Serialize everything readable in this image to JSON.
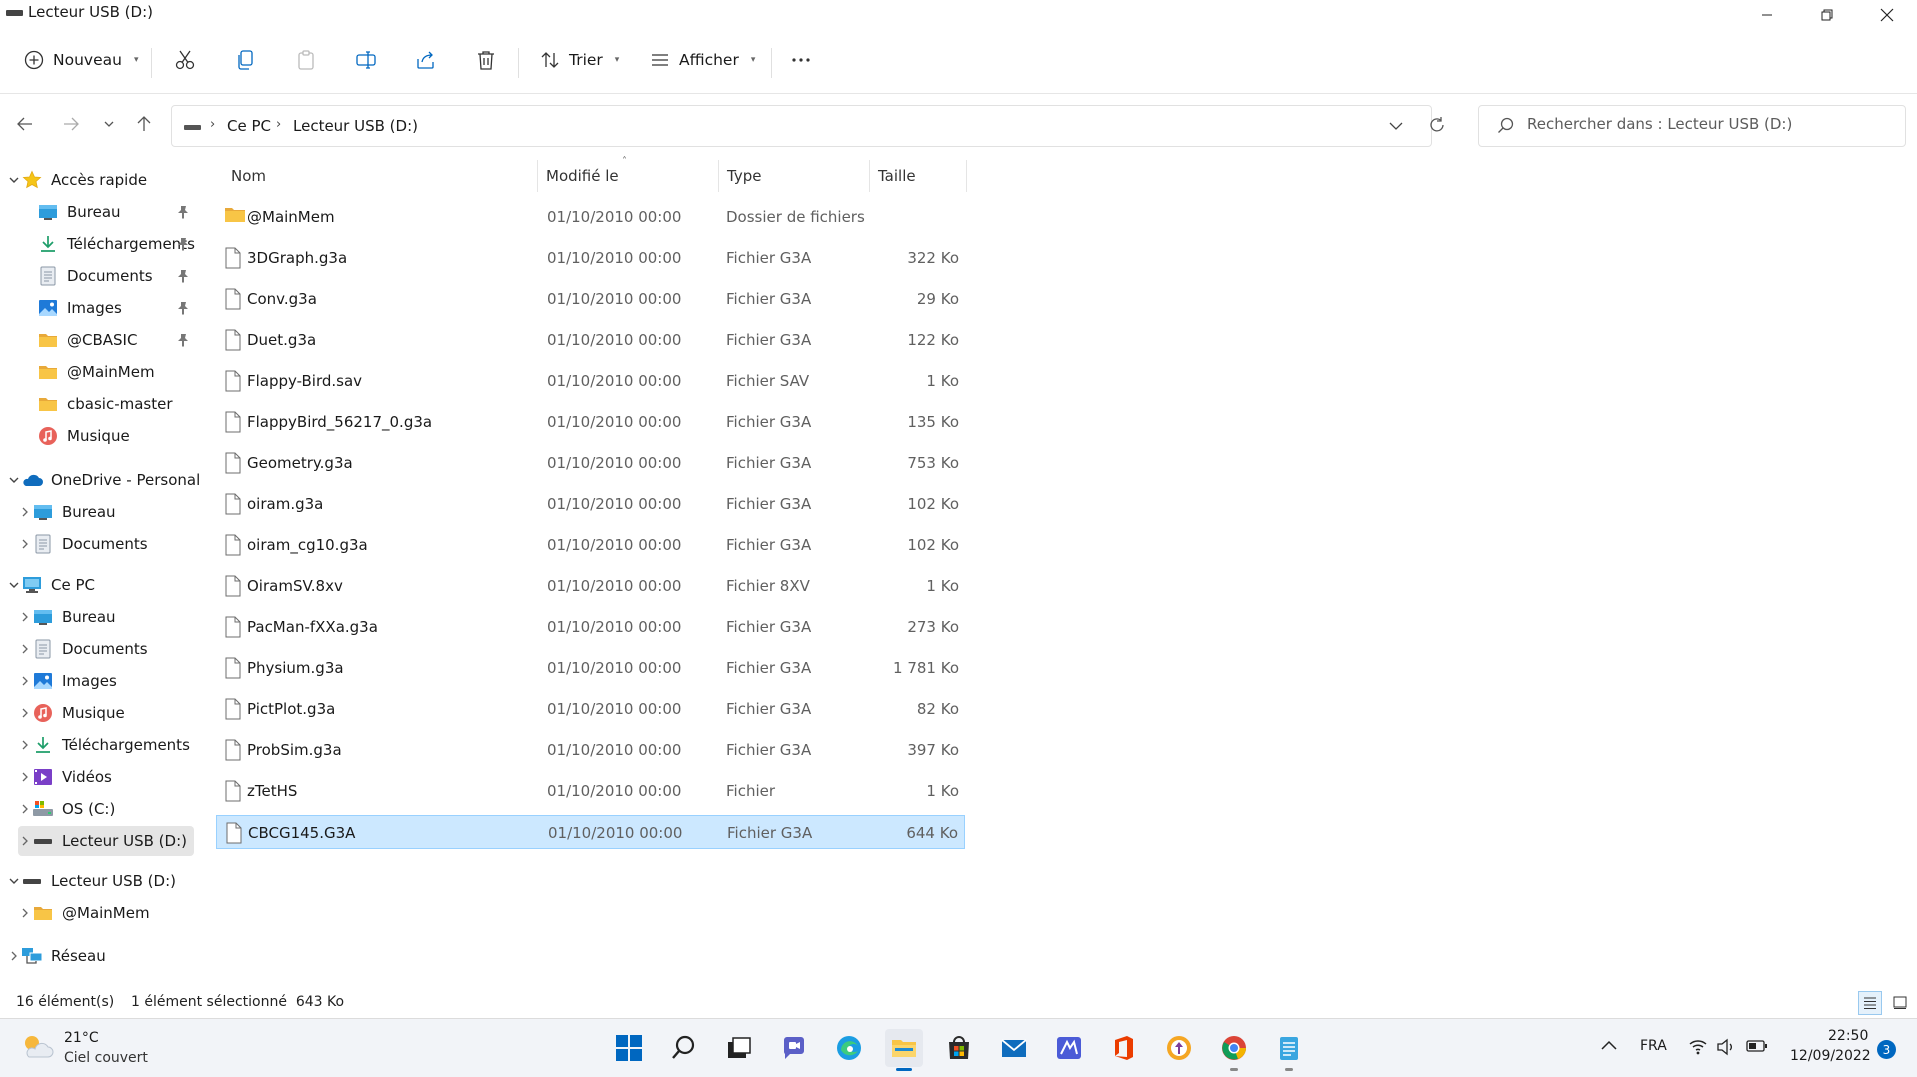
{
  "window": {
    "title": "Lecteur USB (D:)",
    "minimize_icon": "minimize-icon",
    "maximize_icon": "restore-icon",
    "close_icon": "close-icon"
  },
  "commandbar": {
    "new_label": "Nouveau",
    "sort_label": "Trier",
    "view_label": "Afficher",
    "icons": [
      "cut-icon",
      "copy-icon",
      "paste-icon",
      "rename-icon",
      "share-icon",
      "delete-icon",
      "more-icon"
    ]
  },
  "address": {
    "crumbs": [
      "Ce PC",
      "Lecteur USB (D:)"
    ]
  },
  "search": {
    "placeholder": "Rechercher dans : Lecteur USB (D:)"
  },
  "sidebar": {
    "quick_access": "Accès rapide",
    "quick_items": [
      {
        "label": "Bureau",
        "pinned": true
      },
      {
        "label": "Téléchargements",
        "pinned": true
      },
      {
        "label": "Documents",
        "pinned": true
      },
      {
        "label": "Images",
        "pinned": true
      },
      {
        "label": "@CBASIC",
        "pinned": true
      },
      {
        "label": "@MainMem",
        "pinned": false
      },
      {
        "label": "cbasic-master",
        "pinned": false
      },
      {
        "label": "Musique",
        "pinned": false
      }
    ],
    "onedrive": "OneDrive - Personal",
    "onedrive_items": [
      "Bureau",
      "Documents"
    ],
    "this_pc": "Ce PC",
    "pc_items": [
      "Bureau",
      "Documents",
      "Images",
      "Musique",
      "Téléchargements",
      "Vidéos",
      "OS (C:)",
      "Lecteur USB (D:)"
    ],
    "usb": "Lecteur USB (D:)",
    "usb_items": [
      "@MainMem"
    ],
    "network": "Réseau"
  },
  "columns": {
    "name": "Nom",
    "modified": "Modifié le",
    "type": "Type",
    "size": "Taille"
  },
  "files": [
    {
      "name": "@MainMem",
      "date": "01/10/2010 00:00",
      "type": "Dossier de fichiers",
      "size": "",
      "folder": true
    },
    {
      "name": "3DGraph.g3a",
      "date": "01/10/2010 00:00",
      "type": "Fichier G3A",
      "size": "322 Ko"
    },
    {
      "name": "Conv.g3a",
      "date": "01/10/2010 00:00",
      "type": "Fichier G3A",
      "size": "29 Ko"
    },
    {
      "name": "Duet.g3a",
      "date": "01/10/2010 00:00",
      "type": "Fichier G3A",
      "size": "122 Ko"
    },
    {
      "name": "Flappy-Bird.sav",
      "date": "01/10/2010 00:00",
      "type": "Fichier SAV",
      "size": "1 Ko"
    },
    {
      "name": "FlappyBird_56217_0.g3a",
      "date": "01/10/2010 00:00",
      "type": "Fichier G3A",
      "size": "135 Ko"
    },
    {
      "name": "Geometry.g3a",
      "date": "01/10/2010 00:00",
      "type": "Fichier G3A",
      "size": "753 Ko"
    },
    {
      "name": "oiram.g3a",
      "date": "01/10/2010 00:00",
      "type": "Fichier G3A",
      "size": "102 Ko"
    },
    {
      "name": "oiram_cg10.g3a",
      "date": "01/10/2010 00:00",
      "type": "Fichier G3A",
      "size": "102 Ko"
    },
    {
      "name": "OiramSV.8xv",
      "date": "01/10/2010 00:00",
      "type": "Fichier 8XV",
      "size": "1 Ko"
    },
    {
      "name": "PacMan-fXXa.g3a",
      "date": "01/10/2010 00:00",
      "type": "Fichier G3A",
      "size": "273 Ko"
    },
    {
      "name": "Physium.g3a",
      "date": "01/10/2010 00:00",
      "type": "Fichier G3A",
      "size": "1 781 Ko"
    },
    {
      "name": "PictPlot.g3a",
      "date": "01/10/2010 00:00",
      "type": "Fichier G3A",
      "size": "82 Ko"
    },
    {
      "name": "ProbSim.g3a",
      "date": "01/10/2010 00:00",
      "type": "Fichier G3A",
      "size": "397 Ko"
    },
    {
      "name": "zTetHS",
      "date": "01/10/2010 00:00",
      "type": "Fichier",
      "size": "1 Ko"
    },
    {
      "name": "CBCG145.G3A",
      "date": "01/10/2010 00:00",
      "type": "Fichier G3A",
      "size": "644 Ko",
      "selected": true
    }
  ],
  "status": {
    "count": "16 élément(s)",
    "selection": "1 élément sélectionné  643 Ko"
  },
  "taskbar": {
    "temperature": "21°C",
    "weather": "Ciel couvert",
    "language": "FRA",
    "time": "22:50",
    "date": "12/09/2022",
    "notifications": "3",
    "apps": [
      "start-icon",
      "search-icon",
      "task-view-icon",
      "chat-icon",
      "edge-icon",
      "file-explorer-icon",
      "store-icon",
      "mail-icon",
      "app-icon",
      "office-icon",
      "vpn-icon",
      "chrome-icon",
      "notepad-icon"
    ]
  },
  "colors": {
    "selection_bg": "#cce8ff",
    "selection_border": "#99d1ff",
    "accent": "#0067c0",
    "folder": "#f8c546"
  }
}
